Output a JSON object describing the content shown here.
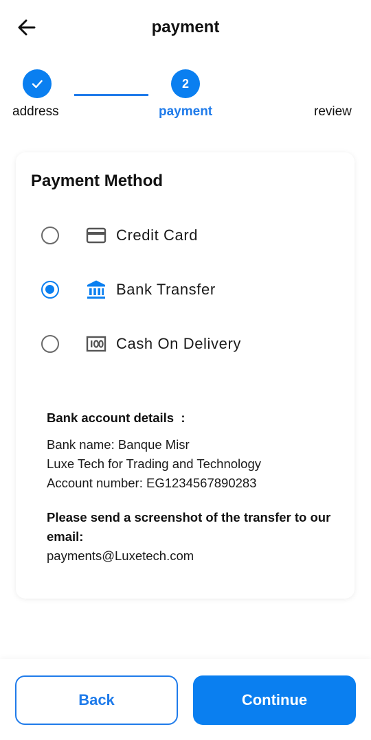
{
  "header": {
    "title": "payment",
    "back_icon": "arrow-left-icon"
  },
  "stepper": {
    "steps": [
      {
        "label": "address",
        "state": "completed",
        "indicator": "check-icon"
      },
      {
        "label": "payment",
        "state": "active",
        "number": "2"
      },
      {
        "label": "review",
        "state": "upcoming"
      }
    ]
  },
  "payment_method": {
    "title": "Payment Method",
    "options": [
      {
        "label": "Credit Card",
        "icon": "credit-card-icon",
        "selected": false
      },
      {
        "label": "Bank Transfer",
        "icon": "bank-icon",
        "selected": true
      },
      {
        "label": "Cash On Delivery",
        "icon": "cash-icon",
        "selected": false
      }
    ]
  },
  "bank_details": {
    "heading": "Bank account details  :",
    "lines": [
      "Bank name: Banque Misr",
      "Luxe Tech for Trading and Technology",
      "Account number: EG1234567890283"
    ],
    "note": "Please send a screenshot of the transfer to our email:",
    "email": "payments@Luxetech.com"
  },
  "actions": {
    "back_label": "Back",
    "continue_label": "Continue"
  },
  "colors": {
    "accent": "#0a7ff0",
    "text": "#111111",
    "radio_unselected": "#6a6a6a",
    "icon_gray": "#555555"
  }
}
